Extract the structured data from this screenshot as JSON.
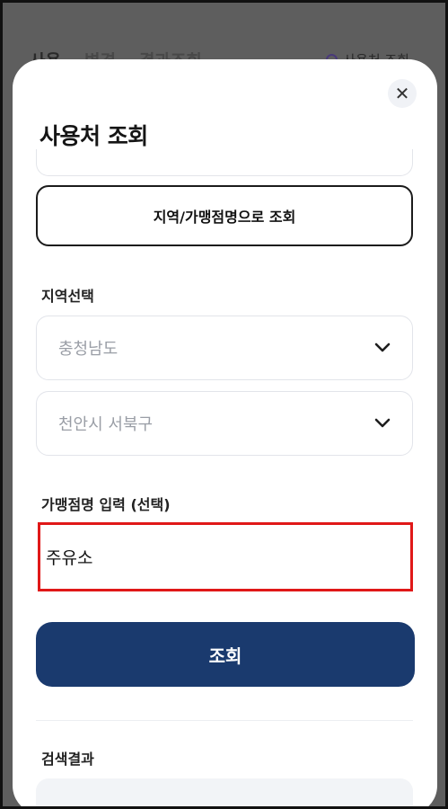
{
  "background": {
    "tabs": [
      "사용",
      "변경",
      "결과조회"
    ],
    "right_link": "사용처 조회"
  },
  "modal": {
    "title": "사용처 조회",
    "close_symbol": "✕",
    "region_button_label": "지역/가맹점명으로 조회",
    "region_section_label": "지역선택",
    "province_select": {
      "value": "충청남도"
    },
    "city_select": {
      "value": "천안시 서북구"
    },
    "store_section_label": "가맹점명 입력 (선택)",
    "store_input": {
      "value": "주유소"
    },
    "submit_label": "조회",
    "results_label": "검색결과"
  },
  "colors": {
    "primary": "#1a3a6e",
    "highlight": "#e01818"
  }
}
